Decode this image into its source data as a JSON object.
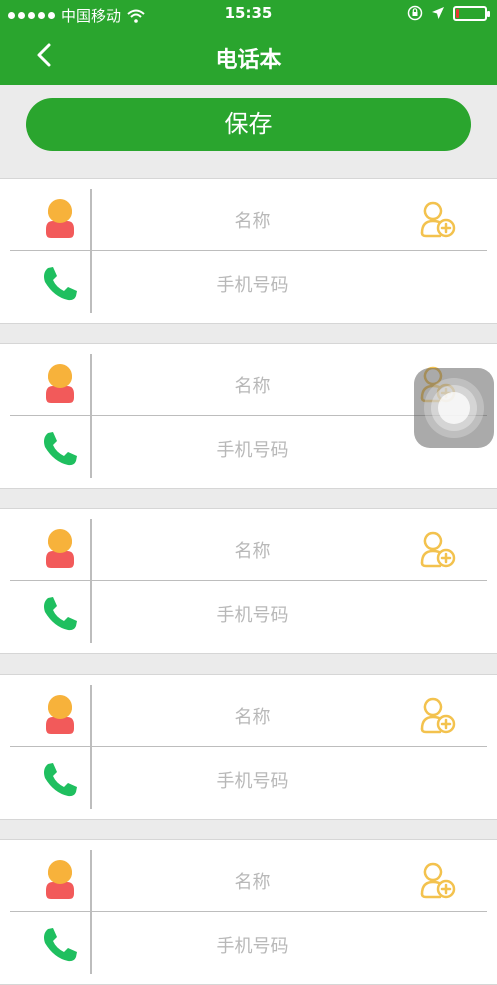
{
  "status_bar": {
    "carrier": "中国移动",
    "time": "15:35",
    "battery_level": 0.1
  },
  "nav": {
    "back_icon": "chevron-left-icon",
    "title": "电话本"
  },
  "save_button": {
    "label": "保存"
  },
  "contacts": [
    {
      "name_placeholder": "名称",
      "phone_placeholder": "手机号码"
    },
    {
      "name_placeholder": "名称",
      "phone_placeholder": "手机号码"
    },
    {
      "name_placeholder": "名称",
      "phone_placeholder": "手机号码"
    },
    {
      "name_placeholder": "名称",
      "phone_placeholder": "手机号码"
    },
    {
      "name_placeholder": "名称",
      "phone_placeholder": "手机号码"
    }
  ],
  "colors": {
    "brand_green": "#2aa52e",
    "avatar_head": "#f7b23b",
    "avatar_body": "#f25a5a",
    "phone_green": "#1fbf5f",
    "add_contact_orange": "#f3c24e",
    "placeholder_gray": "#b8b8b8"
  }
}
